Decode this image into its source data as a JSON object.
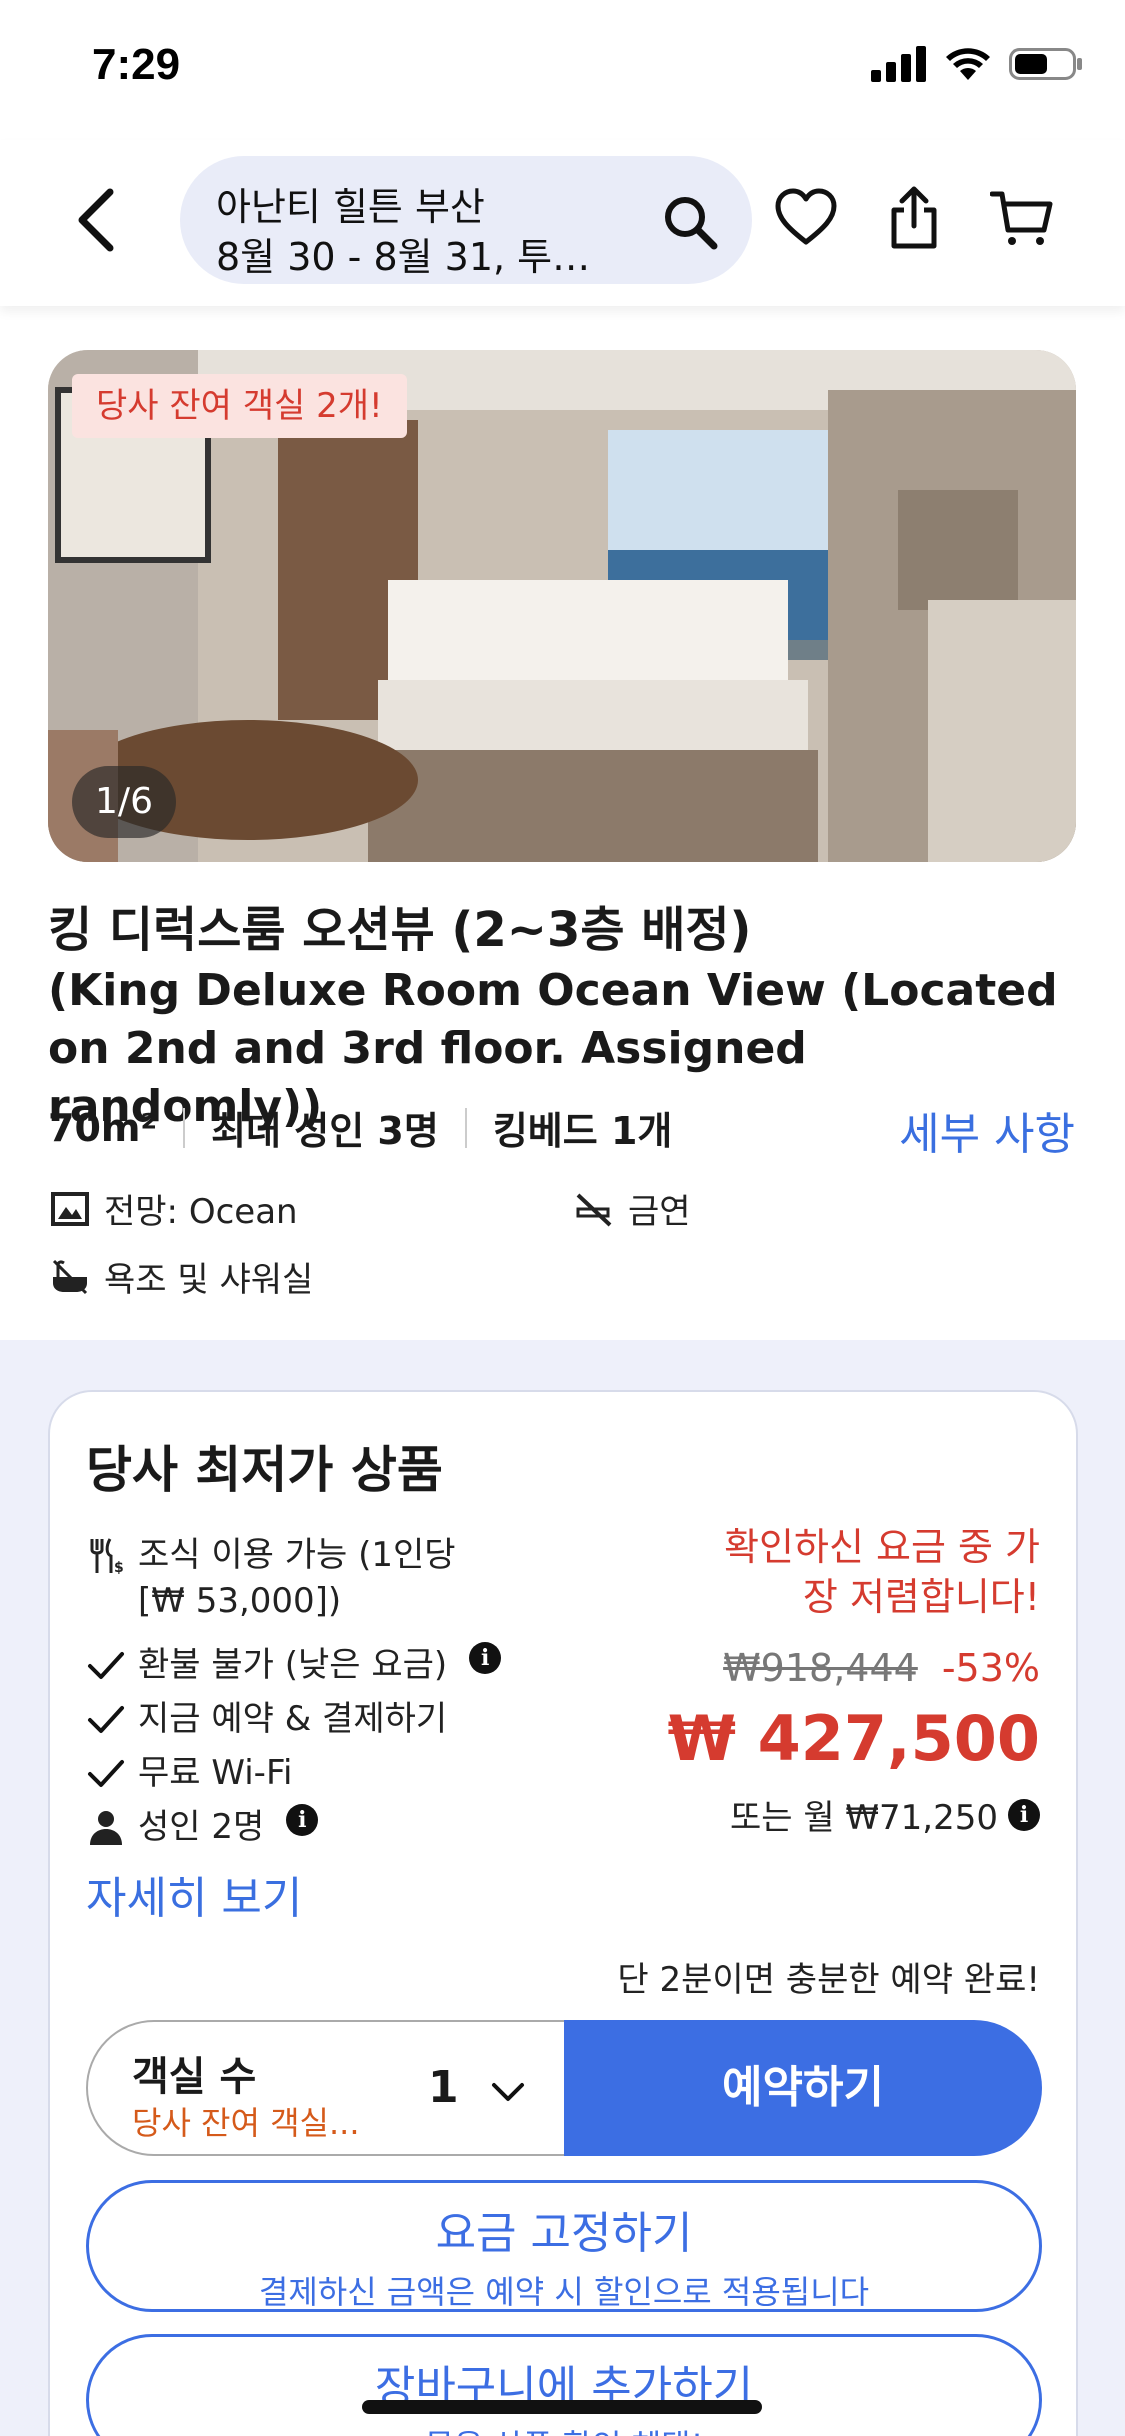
{
  "status_bar": {
    "time": "7:29"
  },
  "header": {
    "search_title": "아난티 힐튼 부산",
    "search_subtitle": "8월 30 - 8월 31, 투…"
  },
  "photo": {
    "availability_badge": "당사 잔여 객실 2개!",
    "counter": "1/6"
  },
  "room": {
    "title_ko": "킹 디럭스룸 오션뷰 (2~3층 배정)",
    "title_en": "(King Deluxe Room Ocean View (Located on 2nd and 3rd floor. Assigned randomly))",
    "specs": [
      "70m²",
      "최대 성인 3명",
      "킹베드 1개"
    ],
    "details_link": "세부 사항",
    "amenities": {
      "view": "전망: Ocean",
      "smoking": "금연",
      "bath": "욕조 및 샤워실"
    }
  },
  "offer": {
    "title": "당사 최저가 상품",
    "features": {
      "breakfast": "조식 이용 가능 (1인당 [₩ 53,000])",
      "refund": "환불 불가 (낮은 요금)",
      "pay_now": "지금 예약 & 결제하기",
      "wifi": "무료 Wi-Fi",
      "guests": "성인 2명"
    },
    "more_link": "자세히 보기",
    "price_note": "확인하신 요금 중 가장 저렴합니다!",
    "original_price": "₩918,444",
    "discount": "-53%",
    "current_price": "₩ 427,500",
    "monthly_price": "또는 월 ₩71,250",
    "quick_note": "단 2분이면 충분한 예약 완료!",
    "rooms_label": "객실 수",
    "rooms_sub": "당사 잔여 객실...",
    "rooms_value": "1",
    "book_button": "예약하기",
    "lock_rate": {
      "title": "요금 고정하기",
      "subtitle": "결제하신 금액은 예약 시 할인으로 적용됩니다"
    },
    "add_cart": {
      "title": "장바구니에 추가하기",
      "subtitle": "묶음 상품 할인 혜택!"
    }
  },
  "colors": {
    "accent": "#3c6ee3",
    "price_red": "#d53b2f",
    "background_tint": "#eef0fa"
  }
}
